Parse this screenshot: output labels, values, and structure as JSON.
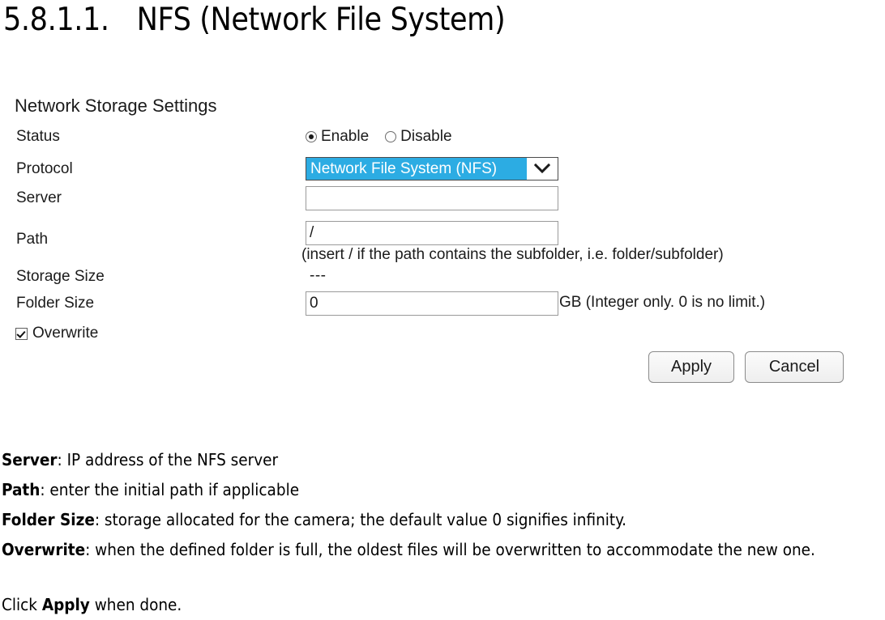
{
  "heading": {
    "number": "5.8.1.1.",
    "title": "NFS (Network File System)"
  },
  "settings_panel": {
    "title": "Network Storage Settings",
    "labels": {
      "status": "Status",
      "protocol": "Protocol",
      "server": "Server",
      "path": "Path",
      "storage_size": "Storage Size",
      "folder_size": "Folder Size"
    },
    "status": {
      "enable_label": "Enable",
      "disable_label": "Disable",
      "selected": "Enable"
    },
    "protocol": {
      "selected_option": "Network File System (NFS)",
      "highlight_color": "#2cace3"
    },
    "server": {
      "value": "",
      "placeholder": ""
    },
    "path": {
      "value": "/",
      "hint": "(insert / if the path contains the subfolder, i.e. folder/subfolder)"
    },
    "storage_size": {
      "value": "---"
    },
    "folder_size": {
      "value": "0",
      "suffix": "GB (Integer only. 0 is no limit.)"
    },
    "overwrite": {
      "label": "Overwrite",
      "checked": "true"
    },
    "buttons": {
      "apply": "Apply",
      "cancel": "Cancel"
    }
  },
  "descriptions": {
    "server": {
      "term": "Server",
      "text": ": IP address of the NFS server"
    },
    "path": {
      "term": "Path",
      "text": ": enter the initial path if applicable"
    },
    "folder_size": {
      "term": "Folder Size",
      "text": ": storage allocated for the camera; the default value 0 signifies infinity."
    },
    "overwrite": {
      "term": "Overwrite",
      "text": ": when the defined folder is full, the oldest files will be overwritten to accommodate the new one."
    }
  },
  "footer": {
    "prefix": "Click ",
    "action": "Apply",
    "suffix": " when done."
  }
}
